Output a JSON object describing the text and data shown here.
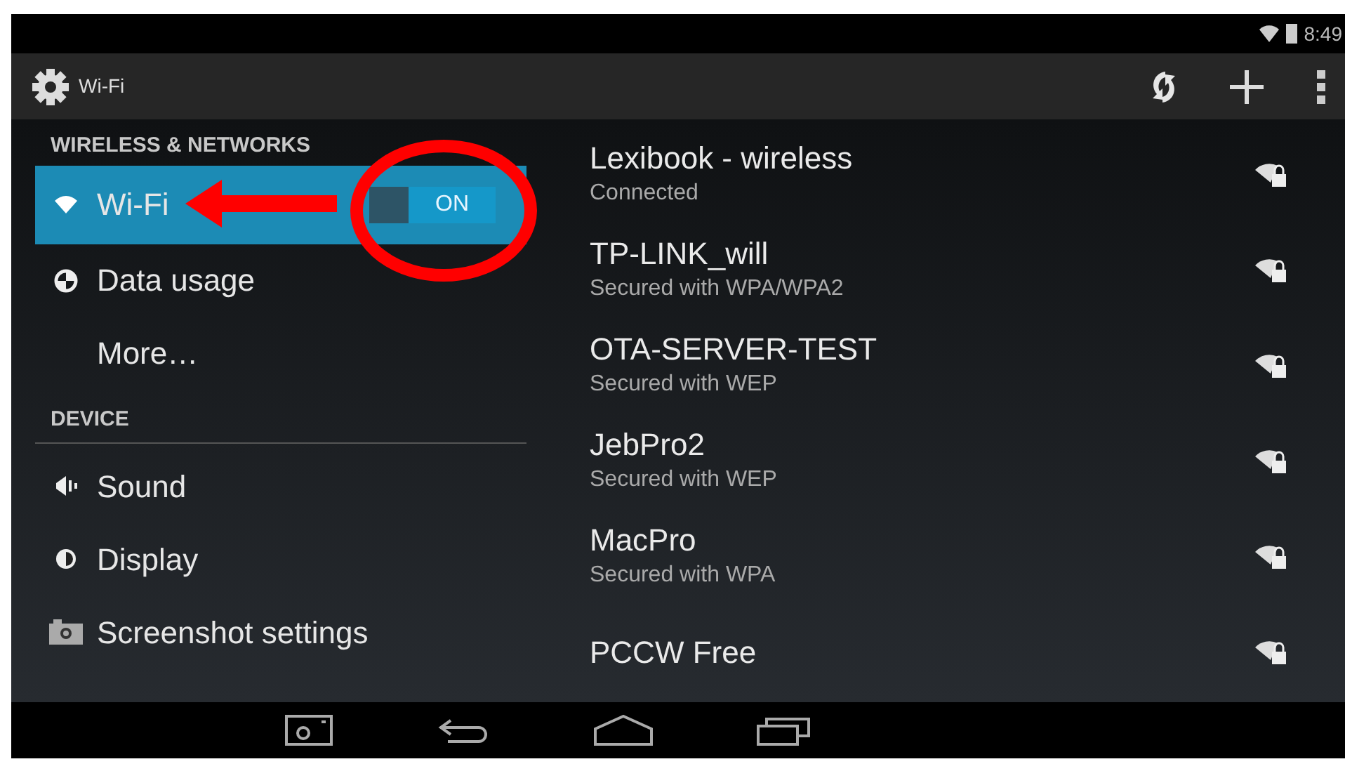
{
  "status_bar": {
    "time": "8:49"
  },
  "action_bar": {
    "title": "Wi-Fi"
  },
  "sidebar": {
    "sections": [
      {
        "header": "WIRELESS & NETWORKS",
        "items": [
          {
            "kind": "wifi",
            "label": "Wi-Fi",
            "selected": true,
            "switch": {
              "label": "ON",
              "on": true
            }
          },
          {
            "kind": "data",
            "label": "Data usage",
            "selected": false
          },
          {
            "kind": "more",
            "label": "More…",
            "selected": false
          }
        ]
      },
      {
        "header": "DEVICE",
        "items": [
          {
            "kind": "sound",
            "label": "Sound",
            "selected": false
          },
          {
            "kind": "display",
            "label": "Display",
            "selected": false
          },
          {
            "kind": "camera",
            "label": "Screenshot settings",
            "selected": false
          }
        ]
      }
    ]
  },
  "networks": [
    {
      "name": "Lexibook - wireless",
      "status": "Connected"
    },
    {
      "name": "TP-LINK_will",
      "status": "Secured with WPA/WPA2"
    },
    {
      "name": "OTA-SERVER-TEST",
      "status": "Secured with WEP"
    },
    {
      "name": "JebPro2",
      "status": "Secured with WEP"
    },
    {
      "name": "MacPro",
      "status": "Secured with WPA"
    },
    {
      "name": "PCCW Free"
    }
  ]
}
